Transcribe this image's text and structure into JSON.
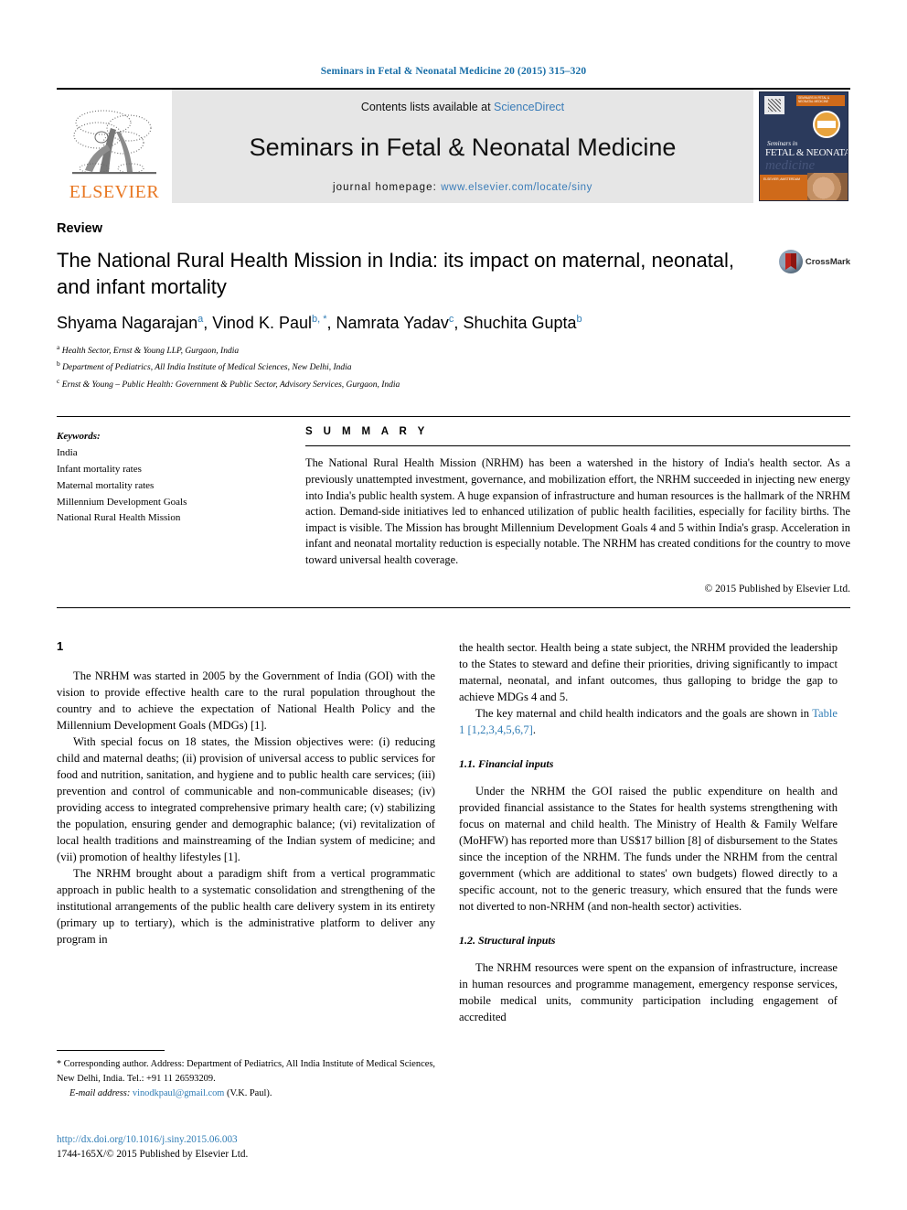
{
  "running_head": "Seminars in Fetal & Neonatal Medicine 20 (2015) 315–320",
  "masthead": {
    "publisher_wordmark": "ELSEVIER",
    "contents_prefix": "Contents lists available at ",
    "contents_link": "ScienceDirect",
    "journal_title": "Seminars in Fetal & Neonatal Medicine",
    "homepage_prefix": "journal homepage: ",
    "homepage_link": "www.elsevier.com/locate/siny",
    "cover": {
      "top_band": "SEMINARS IN FETAL & NEONATAL MEDICINE",
      "script_line": "Seminars in",
      "big_title": "FETAL & NEONATAL",
      "ghost_word": "medicine",
      "lower_band_text": "ELSEVIER, AMSTERDAM"
    }
  },
  "article": {
    "type": "Review",
    "title": "The National Rural Health Mission in India: its impact on maternal, neonatal, and infant mortality",
    "crossmark_label": "CrossMark",
    "authors": [
      {
        "name": "Shyama Nagarajan",
        "marks": "a"
      },
      {
        "name": "Vinod K. Paul",
        "marks": "b, *"
      },
      {
        "name": "Namrata Yadav",
        "marks": "c"
      },
      {
        "name": "Shuchita Gupta",
        "marks": "b"
      }
    ],
    "affiliations": [
      {
        "mark": "a",
        "text": "Health Sector, Ernst & Young LLP, Gurgaon, India"
      },
      {
        "mark": "b",
        "text": "Department of Pediatrics, All India Institute of Medical Sciences, New Delhi, India"
      },
      {
        "mark": "c",
        "text": "Ernst & Young – Public Health: Government & Public Sector, Advisory Services, Gurgaon, India"
      }
    ]
  },
  "keywords": {
    "heading": "Keywords:",
    "items": [
      "India",
      "Infant mortality rates",
      "Maternal mortality rates",
      "Millennium Development Goals",
      "National Rural Health Mission"
    ]
  },
  "summary": {
    "heading": "S U M M A R Y",
    "text": "The National Rural Health Mission (NRHM) has been a watershed in the history of India's health sector. As a previously unattempted investment, governance, and mobilization effort, the NRHM succeeded in injecting new energy into India's public health system. A huge expansion of infrastructure and human resources is the hallmark of the NRHM action. Demand-side initiatives led to enhanced utilization of public health facilities, especially for facility births. The impact is visible. The Mission has brought Millennium Development Goals 4 and 5 within India's grasp. Acceleration in infant and neonatal mortality reduction is especially notable. The NRHM has created conditions for the country to move toward universal health coverage.",
    "copyright": "© 2015 Published by Elsevier Ltd."
  },
  "body": {
    "section_number": "1",
    "left_paragraphs": [
      "The NRHM was started in 2005 by the Government of India (GOI) with the vision to provide effective health care to the rural population throughout the country and to achieve the expectation of National Health Policy and the Millennium Development Goals (MDGs) [1].",
      "With special focus on 18 states, the Mission objectives were: (i) reducing child and maternal deaths; (ii) provision of universal access to public services for food and nutrition, sanitation, and hygiene and to public health care services; (iii) prevention and control of communicable and non-communicable diseases; (iv) providing access to integrated comprehensive primary health care; (v) stabilizing the population, ensuring gender and demographic balance; (vi) revitalization of local health traditions and mainstreaming of the Indian system of medicine; and (vii) promotion of healthy lifestyles [1].",
      "The NRHM brought about a paradigm shift from a vertical programmatic approach in public health to a systematic consolidation and strengthening of the institutional arrangements of the public health care delivery system in its entirety (primary up to tertiary), which is the administrative platform to deliver any program in"
    ],
    "right_intro_paragraphs": [
      "the health sector. Health being a state subject, the NRHM provided the leadership to the States to steward and define their priorities, driving significantly to impact maternal, neonatal, and infant outcomes, thus galloping to bridge the gap to achieve MDGs 4 and 5.",
      "The key maternal and child health indicators and the goals are shown in Table 1 [1,2,3,4,5,6,7]."
    ],
    "table_ref_link": "Table 1",
    "table_ref_citation": "[1,2,3,4,5,6,7]",
    "subsections": [
      {
        "heading": "1.1. Financial inputs",
        "paragraphs": [
          "Under the NRHM the GOI raised the public expenditure on health and provided financial assistance to the States for health systems strengthening with focus on maternal and child health. The Ministry of Health & Family Welfare (MoHFW) has reported more than US$17 billion [8] of disbursement to the States since the inception of the NRHM. The funds under the NRHM from the central government (which are additional to states' own budgets) flowed directly to a specific account, not to the generic treasury, which ensured that the funds were not diverted to non-NRHM (and non-health sector) activities."
        ]
      },
      {
        "heading": "1.2. Structural inputs",
        "paragraphs": [
          "The NRHM resources were spent on the expansion of infrastructure, increase in human resources and programme management, emergency response services, mobile medical units, community participation including engagement of accredited"
        ]
      }
    ]
  },
  "footnote": {
    "star": "*",
    "corresponding": "Corresponding author. Address: Department of Pediatrics, All India Institute of Medical Sciences, New Delhi, India. Tel.: +91 11 26593209.",
    "email_label": "E-mail address:",
    "email": "vinodkpaul@gmail.com",
    "email_owner": "(V.K. Paul)."
  },
  "footer": {
    "doi": "http://dx.doi.org/10.1016/j.siny.2015.06.003",
    "issn_line": "1744-165X/© 2015 Published by Elsevier Ltd."
  },
  "colors": {
    "link_blue": "#2f7cb5",
    "header_blue": "#1a6fa8",
    "elsevier_orange": "#E87722",
    "banner_gray": "#e6e6e6",
    "cover_navy": "#2b3a5c"
  }
}
